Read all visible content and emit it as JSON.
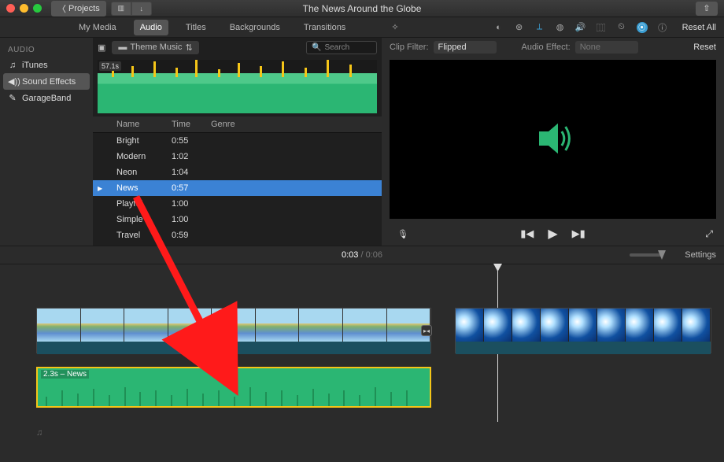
{
  "window": {
    "title": "The News Around the Globe",
    "back": "Projects"
  },
  "tabs": [
    "My Media",
    "Audio",
    "Titles",
    "Backgrounds",
    "Transitions"
  ],
  "active_tab": 1,
  "sidebar": {
    "header": "AUDIO",
    "items": [
      {
        "icon": "♫",
        "label": "iTunes"
      },
      {
        "icon": "◀))",
        "label": "Sound Effects"
      },
      {
        "icon": "✎",
        "label": "GarageBand"
      }
    ],
    "selected": 1
  },
  "browser": {
    "folder": "Theme Music",
    "search_placeholder": "Search",
    "preview_duration": "57.1s",
    "columns": [
      "Name",
      "Time",
      "Genre"
    ],
    "rows": [
      {
        "name": "Bright",
        "time": "0:55"
      },
      {
        "name": "Modern",
        "time": "1:02"
      },
      {
        "name": "Neon",
        "time": "1:04"
      },
      {
        "name": "News",
        "time": "0:57"
      },
      {
        "name": "Playful",
        "time": "1:00"
      },
      {
        "name": "Simple",
        "time": "1:00"
      },
      {
        "name": "Travel",
        "time": "0:59"
      }
    ],
    "selected": 3
  },
  "inspector": {
    "reset_all": "Reset All",
    "clip_filter_label": "Clip Filter:",
    "clip_filter_value": "Flipped",
    "audio_effect_label": "Audio Effect:",
    "audio_effect_value": "None",
    "reset": "Reset"
  },
  "timecode": {
    "current": "0:03",
    "total": "0:06",
    "settings": "Settings"
  },
  "timeline": {
    "audio_clip_label": "2.3s – News"
  },
  "colors": {
    "accent": "#3b82d4",
    "waveform": "#2bb673",
    "highlight": "#f5c518"
  }
}
